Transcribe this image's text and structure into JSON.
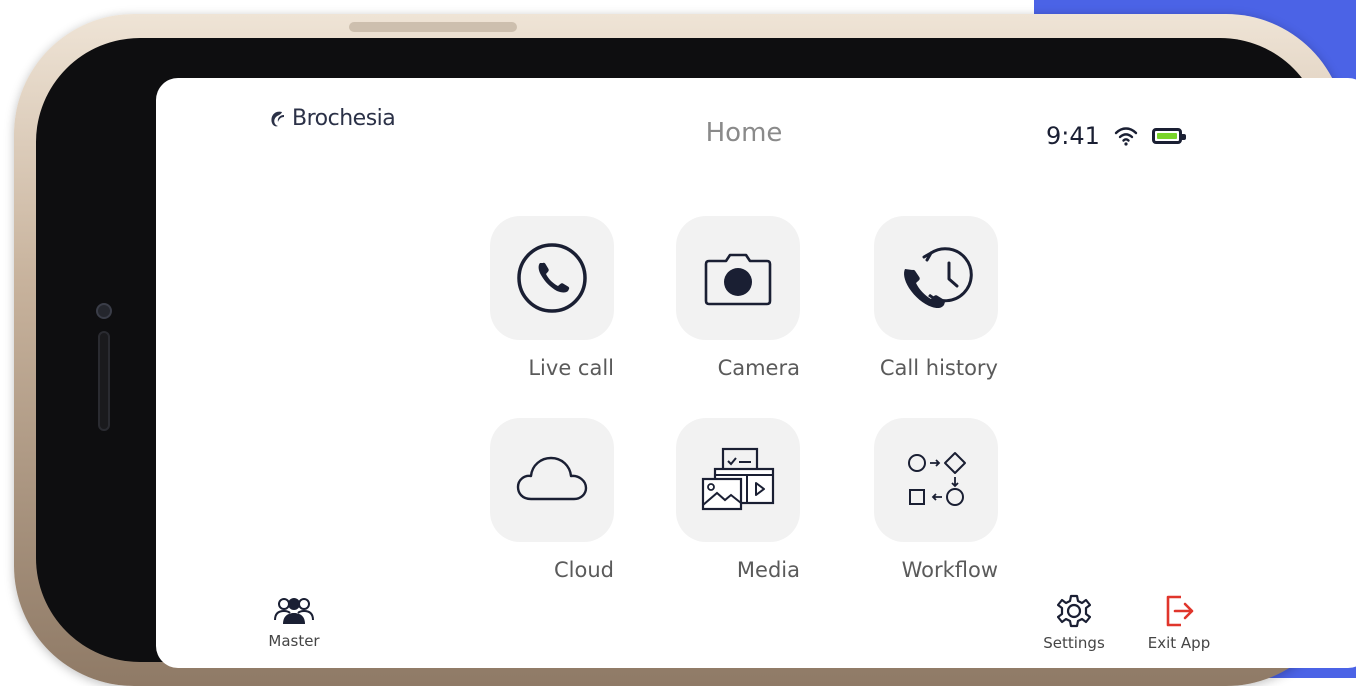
{
  "brand": {
    "name": "Brochesia"
  },
  "header": {
    "title": "Home"
  },
  "status_bar": {
    "time": "9:41",
    "wifi_icon": "wifi-icon",
    "battery_icon": "battery-icon",
    "battery_color": "#79d42a"
  },
  "tiles": [
    {
      "label": "Live call",
      "icon": "phone-icon"
    },
    {
      "label": "Camera",
      "icon": "camera-icon"
    },
    {
      "label": "Call history",
      "icon": "call-history-icon"
    },
    {
      "label": "Cloud",
      "icon": "cloud-icon"
    },
    {
      "label": "Media",
      "icon": "media-icon"
    },
    {
      "label": "Workflow",
      "icon": "workflow-icon"
    }
  ],
  "footer": {
    "master": {
      "label": "Master",
      "icon": "users-icon"
    },
    "settings": {
      "label": "Settings",
      "icon": "gear-icon"
    },
    "exit": {
      "label": "Exit App",
      "icon": "exit-icon",
      "color": "#e0352b"
    }
  },
  "colors": {
    "accent": "#4b63e6",
    "icon": "#1a1f33",
    "tile_bg": "#f2f2f2"
  }
}
